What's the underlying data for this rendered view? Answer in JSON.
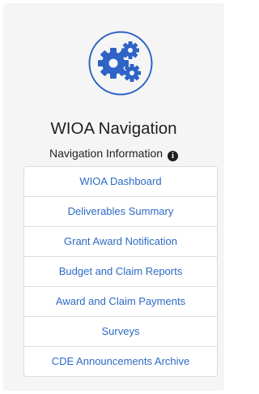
{
  "header": {
    "logo_icon": "gears-icon",
    "title": "WIOA Navigation",
    "subtitle": "Navigation Information",
    "info_icon": "info-icon",
    "info_glyph": "i"
  },
  "nav": {
    "items": [
      {
        "label": "WIOA Dashboard"
      },
      {
        "label": "Deliverables Summary"
      },
      {
        "label": "Grant Award Notification"
      },
      {
        "label": "Budget and Claim Reports"
      },
      {
        "label": "Award and Claim Payments"
      },
      {
        "label": "Surveys"
      },
      {
        "label": "CDE Announcements Archive"
      }
    ]
  },
  "colors": {
    "panel_bg": "#f5f5f5",
    "link": "#2e6ac4",
    "logo": "#2f63c6",
    "border": "#dddddd"
  }
}
